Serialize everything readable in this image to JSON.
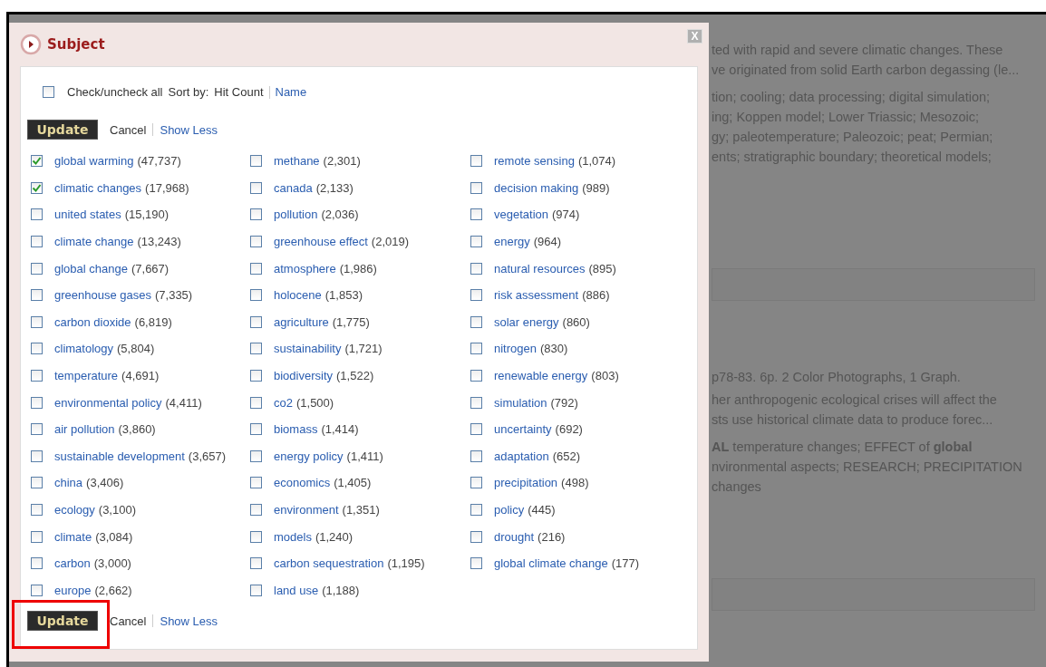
{
  "background": {
    "paragraphs": [
      {
        "lines": [
          "ted with rapid and severe climatic changes. These",
          "ve originated from solid Earth carbon degassing (le..."
        ]
      },
      {
        "lines": [
          "tion; cooling; data processing; digital simulation;",
          "ing; Koppen model; Lower Triassic; Mesozoic;",
          "gy; paleotemperature; Paleozoic; peat; Permian;",
          "ents; stratigraphic boundary; theoretical models;"
        ]
      },
      {
        "lines": [
          "p78-83. 6p. 2 Color Photographs, 1 Graph."
        ]
      },
      {
        "lines": [
          "her anthropogenic ecological crises will affect the",
          "sts use historical climate data to produce forec..."
        ]
      },
      {
        "lines": [
          "**AL** temperature changes; EFFECT of **global**",
          "nvironmental aspects; RESEARCH; PRECIPITATION",
          "changes"
        ]
      }
    ]
  },
  "dialog": {
    "title": "Subject",
    "close": "X",
    "check_all": {
      "label": "Check/uncheck all",
      "checked": false
    },
    "sort": {
      "label": "Sort by:",
      "options": [
        {
          "label": "Hit Count",
          "selected": true
        },
        {
          "label": "Name",
          "selected": false
        }
      ]
    },
    "top_actions": {
      "update": "Update",
      "cancel": "Cancel",
      "show_less": "Show Less"
    },
    "columns": [
      [
        {
          "label": "global warming",
          "count": "(47,737)",
          "checked": true
        },
        {
          "label": "climatic changes",
          "count": "(17,968)",
          "checked": true
        },
        {
          "label": "united states",
          "count": "(15,190)",
          "checked": false
        },
        {
          "label": "climate change",
          "count": "(13,243)",
          "checked": false
        },
        {
          "label": "global change",
          "count": "(7,667)",
          "checked": false
        },
        {
          "label": "greenhouse gases",
          "count": "(7,335)",
          "checked": false
        },
        {
          "label": "carbon dioxide",
          "count": "(6,819)",
          "checked": false
        },
        {
          "label": "climatology",
          "count": "(5,804)",
          "checked": false
        },
        {
          "label": "temperature",
          "count": "(4,691)",
          "checked": false
        },
        {
          "label": "environmental policy",
          "count": "(4,411)",
          "checked": false
        },
        {
          "label": "air pollution",
          "count": "(3,860)",
          "checked": false
        },
        {
          "label": "sustainable development",
          "count": "(3,657)",
          "checked": false
        },
        {
          "label": "china",
          "count": "(3,406)",
          "checked": false
        },
        {
          "label": "ecology",
          "count": "(3,100)",
          "checked": false
        },
        {
          "label": "climate",
          "count": "(3,084)",
          "checked": false
        },
        {
          "label": "carbon",
          "count": "(3,000)",
          "checked": false
        },
        {
          "label": "europe",
          "count": "(2,662)",
          "checked": false
        }
      ],
      [
        {
          "label": "methane",
          "count": "(2,301)",
          "checked": false
        },
        {
          "label": "canada",
          "count": "(2,133)",
          "checked": false
        },
        {
          "label": "pollution",
          "count": "(2,036)",
          "checked": false
        },
        {
          "label": "greenhouse effect",
          "count": "(2,019)",
          "checked": false
        },
        {
          "label": "atmosphere",
          "count": "(1,986)",
          "checked": false
        },
        {
          "label": "holocene",
          "count": "(1,853)",
          "checked": false
        },
        {
          "label": "agriculture",
          "count": "(1,775)",
          "checked": false
        },
        {
          "label": "sustainability",
          "count": "(1,721)",
          "checked": false
        },
        {
          "label": "biodiversity",
          "count": "(1,522)",
          "checked": false
        },
        {
          "label": "co2",
          "count": "(1,500)",
          "checked": false
        },
        {
          "label": "biomass",
          "count": "(1,414)",
          "checked": false
        },
        {
          "label": "energy policy",
          "count": "(1,411)",
          "checked": false
        },
        {
          "label": "economics",
          "count": "(1,405)",
          "checked": false
        },
        {
          "label": "environment",
          "count": "(1,351)",
          "checked": false
        },
        {
          "label": "models",
          "count": "(1,240)",
          "checked": false
        },
        {
          "label": "carbon sequestration",
          "count": "(1,195)",
          "checked": false
        },
        {
          "label": "land use",
          "count": "(1,188)",
          "checked": false
        }
      ],
      [
        {
          "label": "remote sensing",
          "count": "(1,074)",
          "checked": false
        },
        {
          "label": "decision making",
          "count": "(989)",
          "checked": false
        },
        {
          "label": "vegetation",
          "count": "(974)",
          "checked": false
        },
        {
          "label": "energy",
          "count": "(964)",
          "checked": false
        },
        {
          "label": "natural resources",
          "count": "(895)",
          "checked": false
        },
        {
          "label": "risk assessment",
          "count": "(886)",
          "checked": false
        },
        {
          "label": "solar energy",
          "count": "(860)",
          "checked": false
        },
        {
          "label": "nitrogen",
          "count": "(830)",
          "checked": false
        },
        {
          "label": "renewable energy",
          "count": "(803)",
          "checked": false
        },
        {
          "label": "simulation",
          "count": "(792)",
          "checked": false
        },
        {
          "label": "uncertainty",
          "count": "(692)",
          "checked": false
        },
        {
          "label": "adaptation",
          "count": "(652)",
          "checked": false
        },
        {
          "label": "precipitation",
          "count": "(498)",
          "checked": false
        },
        {
          "label": "policy",
          "count": "(445)",
          "checked": false
        },
        {
          "label": "drought",
          "count": "(216)",
          "checked": false
        },
        {
          "label": "global climate change",
          "count": "(177)",
          "checked": false
        }
      ]
    ],
    "bottom_actions": {
      "update": "Update",
      "cancel": "Cancel",
      "show_less": "Show Less",
      "update_highlighted": true
    }
  }
}
